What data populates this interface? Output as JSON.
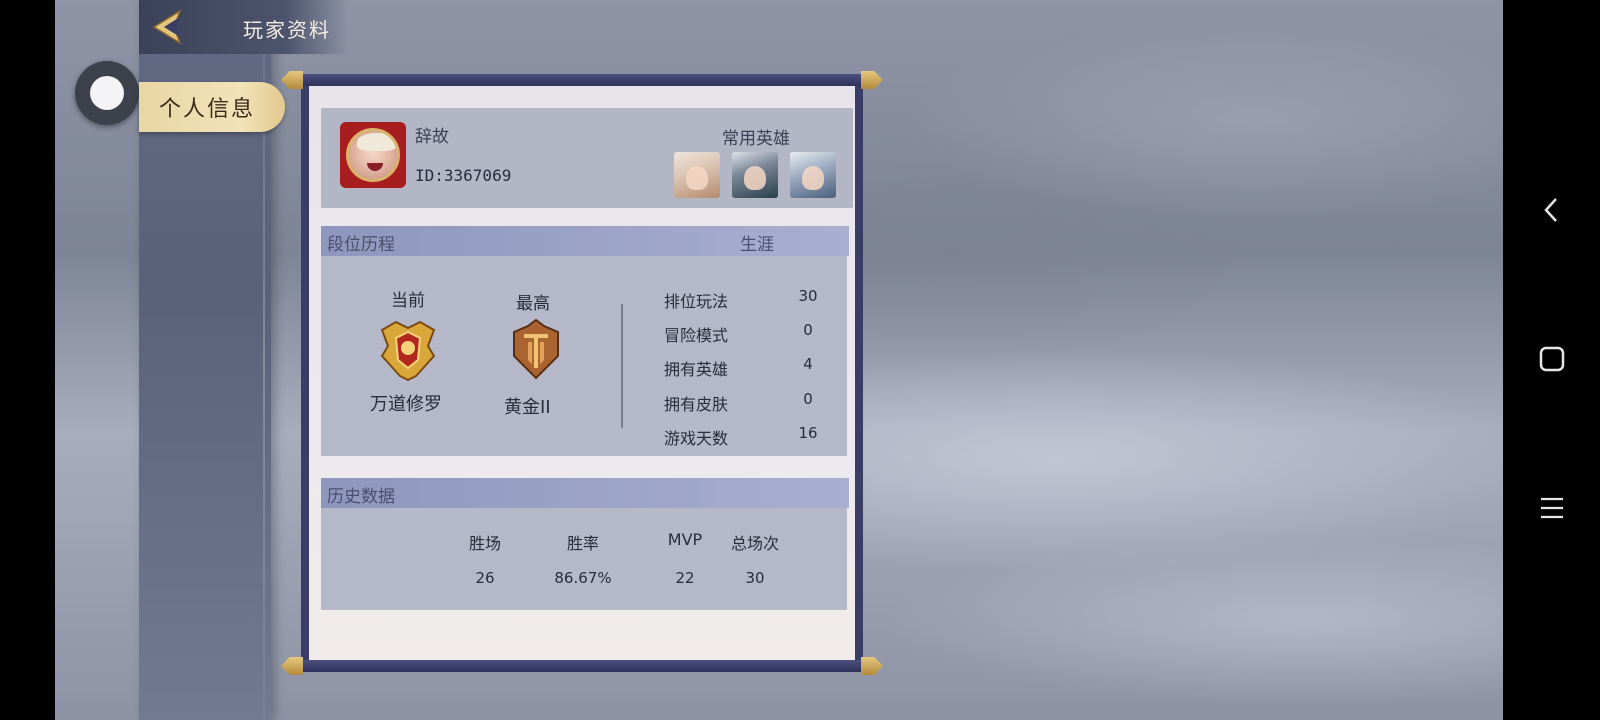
{
  "header": {
    "title": "玩家资料",
    "back_icon": "back-arrow-icon"
  },
  "sidebar": {
    "tabs": [
      {
        "label": "个人信息",
        "selected": true
      }
    ]
  },
  "profile": {
    "name": "辞故",
    "id_text": "ID:3367069",
    "favorite_heroes_label": "常用英雄",
    "favorite_heroes_count": 3
  },
  "rank_history": {
    "title": "段位历程",
    "career_label": "生涯",
    "current": {
      "label": "当前",
      "rank": "万道修罗"
    },
    "highest": {
      "label": "最高",
      "rank": "黄金II"
    },
    "stats": [
      {
        "label": "排位玩法",
        "value": "30"
      },
      {
        "label": "冒险模式",
        "value": "0"
      },
      {
        "label": "拥有英雄",
        "value": "4"
      },
      {
        "label": "拥有皮肤",
        "value": "0"
      },
      {
        "label": "游戏天数",
        "value": "16"
      }
    ]
  },
  "history_data": {
    "title": "历史数据",
    "columns": [
      "胜场",
      "胜率",
      "MVP",
      "总场次"
    ],
    "values": [
      "26",
      "86.67%",
      "22",
      "30"
    ]
  },
  "system_nav": {
    "icons": [
      "back-chevron-icon",
      "home-square-icon",
      "menu-lines-icon"
    ]
  },
  "colors": {
    "accent_gold": "#e1c98d",
    "panel_navy": "#3a3d66",
    "section_bar": "#a8afd0",
    "avatar_frame_red": "#a81d1d"
  }
}
